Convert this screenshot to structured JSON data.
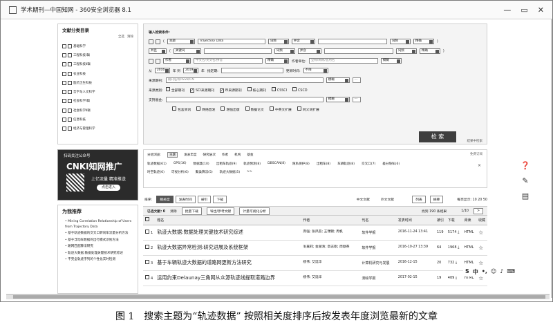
{
  "window": {
    "title": "学术期刊—中国知网 - 360安全浏览器 8.1",
    "controls": [
      "—",
      "▭",
      "✕"
    ]
  },
  "classification": {
    "heading": "文献分类目录",
    "select_all": "全选",
    "clear": "清除",
    "items": [
      "基础科学",
      "工程科技Ⅰ辑",
      "工程科技Ⅱ辑",
      "农业科技",
      "医药卫生科技",
      "哲学与人文科学",
      "社会科学Ⅰ辑",
      "社会科学Ⅱ辑",
      "信息科技",
      "经济与管理科学"
    ]
  },
  "ad": {
    "scan": "扫码关注公众号",
    "headline": "CNKI知网推广",
    "sub": "上亿流量 精准推送",
    "button": "点击进入"
  },
  "hot": {
    "heading": "为我推荐",
    "items": [
      "Mining Correlation Relationship of Users from Trajectory Data",
      "基于轨迹数据的交叉口转向车流量分析方法",
      "基于浮动车数据的出行模式识别方法",
      "路网匹配算法研究",
      "轨迹大数据:数据处理关键技术研究综述",
      "不完全轨迹序列的个性化实时检测"
    ]
  },
  "search": {
    "label": "输入检索条件:",
    "row1": {
      "field": "主题",
      "value": "Trajectory Data",
      "match": "词频",
      "logic": "并含",
      "match2": "词频",
      "exact": "精确"
    },
    "row2": {
      "logic": "并且",
      "field": "关键词",
      "match": "词频",
      "logic2": "并含",
      "match2": "词频",
      "exact": "精确"
    },
    "row3": {
      "field": "作者",
      "placeholder": "中文名/英文名/拼音",
      "exact": "精确",
      "org_label": "作者单位:",
      "org_placeholder": "全称/简称/曾用名",
      "match": "模糊"
    },
    "row4": {
      "from": "从",
      "from_year": "2016",
      "to_word": "年 到",
      "to_year": "2019",
      "year_word": "年",
      "date_label": "指定期:",
      "update_label": "更新时间:",
      "update_val": "不限"
    },
    "row5": {
      "label": "来源期刊:",
      "placeholder": "期刊名称/ISSN/CN",
      "match": "模糊"
    },
    "row6": {
      "label": "来源类别:",
      "options": [
        "全部期刊",
        "SCI来源期刊",
        "EI来源期刊",
        "核心期刊",
        "CSSCI",
        "CSCD"
      ],
      "checked": [
        false,
        true,
        true,
        false,
        false,
        false
      ]
    },
    "row7": {
      "label": "支持基金:",
      "match": "模糊"
    },
    "row8": {
      "options": [
        "包含资讯",
        "网络首发",
        "增强出版",
        "数据论文",
        "中英文扩展",
        "同义词扩展"
      ]
    },
    "button": "检 索",
    "weak": "结果中检索"
  },
  "groups": {
    "tabs": [
      "分组浏览:",
      "主题",
      "发表年度",
      "研究层次",
      "作者",
      "机构",
      "基金"
    ],
    "free": "免费订阅",
    "items": [
      "轨迹数据(61)",
      "GPS(16)",
      "数据集(10)",
      "出租车轨迹(9)",
      "轨迹预测(8)",
      "DBSCAN(8)",
      "隐私保护(8)",
      "出租车(8)",
      "车辆轨迹(8)",
      "交叉口(7)",
      "差分隐私(6)"
    ],
    "items2": [
      "时空轨迹(6)",
      "可视分析(6)",
      "聚类算法(5)",
      "轨迹大数据(5)",
      ">>"
    ]
  },
  "sort": {
    "label": "排序:",
    "options": [
      "相关度",
      "发表时间",
      "被引",
      "下载"
    ],
    "lang_cn": "中文文献",
    "lang_en": "外文文献",
    "view_list": "列表",
    "view_abs": "摘要",
    "per_page": "每页显示: 10 20 50"
  },
  "options": {
    "selected": "已选文献: 0",
    "clear": "清除",
    "batch": "批量下载",
    "export": "导出/参考文献",
    "viz": "计量可视化分析",
    "found": "找到 190 条结果",
    "page": "1/10"
  },
  "table": {
    "headers": [
      "",
      "题名",
      "作者",
      "刊名",
      "发表时间",
      "被引",
      "下载",
      "阅读",
      "收藏"
    ],
    "rows": [
      {
        "n": "1",
        "title": "轨迹大数据:数据处理关键技术研究综述",
        "author": "高强; 张凤荔; 王瑞锦; 周帆",
        "journal": "软件学报",
        "date": "2016-11-24 13:41",
        "cited": "119",
        "down": "5174",
        "read": "HTML"
      },
      {
        "n": "2",
        "title": "轨迹大数据异常检测:研究进展及系统框架",
        "author": "毛嘉莉; 金澈清; 章志刚; 周傲英",
        "journal": "软件学报",
        "date": "2016-10-27 13:39",
        "cited": "64",
        "down": "1968",
        "read": "HTML"
      },
      {
        "n": "3",
        "title": "基于车辆轨迹大数据的道路网更新方法研究",
        "author": "杨伟; 艾廷华",
        "journal": "计算机研究与发展",
        "date": "2016-12-15",
        "cited": "20",
        "down": "732",
        "read": "HTML"
      },
      {
        "n": "4",
        "title": "运用约束Delaunay三角网从众源轨迹线提取道路边界",
        "author": "杨伟; 艾廷华",
        "journal": "测绘学报",
        "date": "2017-02-15",
        "cited": "19",
        "down": "409",
        "read": "HTML"
      }
    ]
  },
  "caption": "图 1　搜索主题为“轨迹数据”  按照相关度排序后按发表年度浏览最新的文章"
}
